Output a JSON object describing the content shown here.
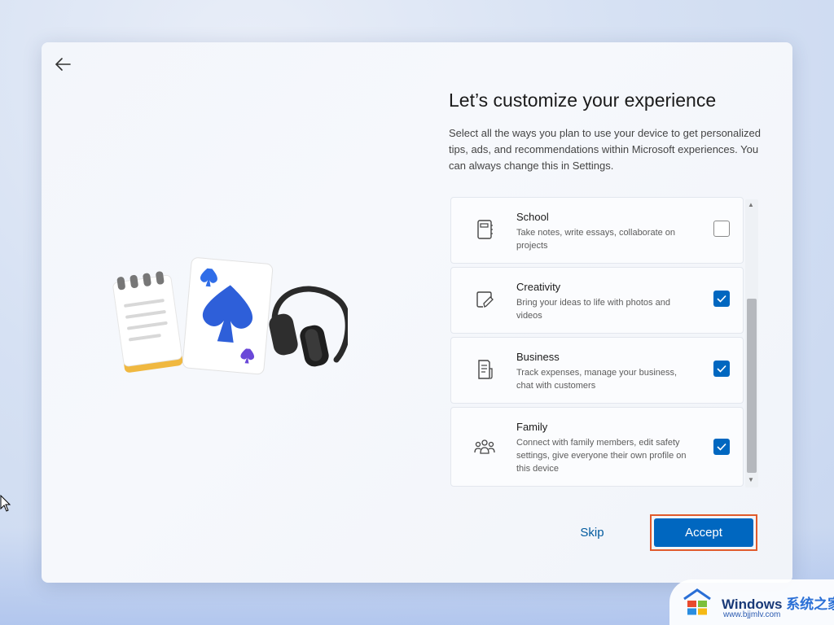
{
  "page": {
    "title": "Let’s customize your experience",
    "description": "Select all the ways you plan to use your device to get personalized tips, ads, and recommendations within Microsoft experiences. You can always change this in Settings."
  },
  "options": [
    {
      "icon": "notebook-icon",
      "title": "School",
      "description": "Take notes, write essays, collaborate on projects",
      "checked": false
    },
    {
      "icon": "pen-paper-icon",
      "title": "Creativity",
      "description": "Bring your ideas to life with photos and videos",
      "checked": true
    },
    {
      "icon": "document-icon",
      "title": "Business",
      "description": "Track expenses, manage your business, chat with customers",
      "checked": true
    },
    {
      "icon": "people-icon",
      "title": "Family",
      "description": "Connect with family members, edit safety settings, give everyone their own profile on this device",
      "checked": true
    }
  ],
  "buttons": {
    "skip": "Skip",
    "accept": "Accept"
  },
  "watermark": {
    "brand": "Windows",
    "brand_cn": "系统之家",
    "url": "www.bjjmlv.com"
  },
  "colors": {
    "accent": "#0067c0",
    "highlight_border": "#e15a2b"
  }
}
